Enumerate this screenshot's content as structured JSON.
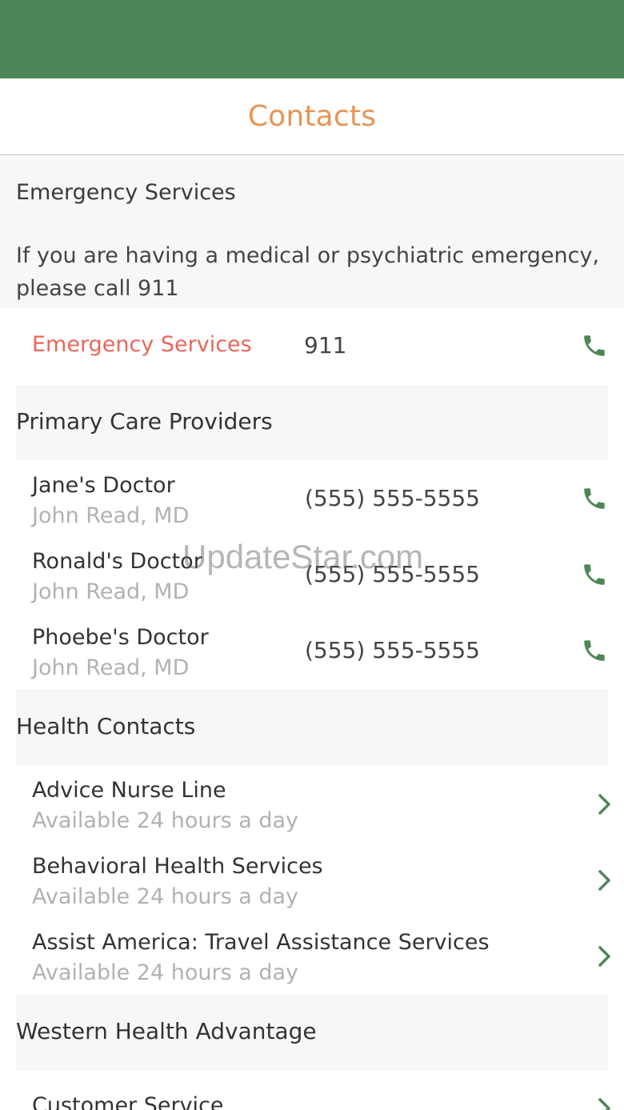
{
  "header": {
    "title": "Contacts"
  },
  "emergency": {
    "heading": "Emergency Services",
    "message": "If you are having a medical or psychiatric emergency, please call 911",
    "row": {
      "name": "Emergency Services",
      "phone": "911",
      "icon": "phone-icon"
    }
  },
  "primary_care": {
    "title": "Primary Care Providers",
    "items": [
      {
        "name": "Jane's Doctor",
        "provider": "John Read, MD",
        "phone": "(555) 555-5555",
        "icon": "phone-icon"
      },
      {
        "name": "Ronald's Doctor",
        "provider": "John Read, MD",
        "phone": "(555) 555-5555",
        "icon": "phone-icon"
      },
      {
        "name": "Phoebe's Doctor",
        "provider": "John Read, MD",
        "phone": "(555) 555-5555",
        "icon": "phone-icon"
      }
    ]
  },
  "health_contacts": {
    "title": "Health Contacts",
    "items": [
      {
        "name": "Advice Nurse Line",
        "availability": "Available 24 hours a day",
        "icon": "chevron-right-icon"
      },
      {
        "name": "Behavioral Health Services",
        "availability": "Available 24 hours a day",
        "icon": "chevron-right-icon"
      },
      {
        "name": "Assist America: Travel Assistance Services",
        "availability": "Available 24 hours a day",
        "icon": "chevron-right-icon"
      }
    ]
  },
  "western_health": {
    "title": "Western Health Advantage",
    "items": [
      {
        "name": "Customer Service",
        "icon": "chevron-right-icon"
      }
    ]
  },
  "watermark": "UpdateStar.com",
  "colors": {
    "status_bar": "#4e8757",
    "title": "#e89454",
    "emergency_label": "#e8675a",
    "icon_green": "#4e8757",
    "section_bg": "#f7f7f7",
    "subtext": "#b2b2b2"
  }
}
